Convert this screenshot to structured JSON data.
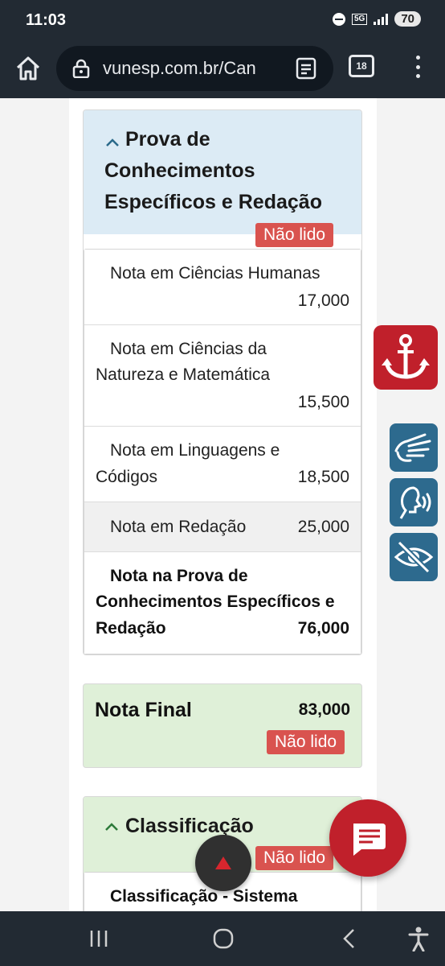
{
  "status_bar": {
    "time": "11:03",
    "network": "5G",
    "battery": "70"
  },
  "browser": {
    "url": "vunesp.com.br/Can",
    "tab_count": "18"
  },
  "card_prova": {
    "title_line1": "Prova de",
    "title_line2": "Conhecimentos",
    "title_line3": "Específicos e Redação",
    "badge": "Não lido",
    "rows": [
      {
        "label_line1": "Nota em Ciências Humanas",
        "value": "17,000"
      },
      {
        "label_line1": "Nota em Ciências da",
        "label_line2": "Natureza e Matemática",
        "value": "15,500"
      },
      {
        "label_line1": "Nota em Linguagens e",
        "label_line2": "Códigos",
        "value": "18,500"
      },
      {
        "label_line1": "Nota em Redação",
        "value": "25,000"
      },
      {
        "label_line1": "Nota na Prova de",
        "label_line2": "Conhecimentos Específicos e",
        "label_line3": "Redação",
        "value": "76,000"
      }
    ]
  },
  "card_final": {
    "title": "Nota Final",
    "value": "83,000",
    "badge": "Não lido"
  },
  "card_classificacao": {
    "title": "Classificação",
    "badge": "Não lido",
    "row_label": "Classificação - Sistema"
  },
  "icons": {
    "anchor": "anchor-icon",
    "sign_language": "sign-language-icon",
    "voice": "speech-icon",
    "visibility": "eye-slash-icon",
    "chat": "chat-icon",
    "scroll_top": "arrow-up-icon"
  },
  "colors": {
    "accent_red": "#c0202b",
    "badge_red": "#d9534f",
    "header_blue": "#dcebf5",
    "header_green": "#dff0d8",
    "acc_blue": "#2d6a8e"
  }
}
